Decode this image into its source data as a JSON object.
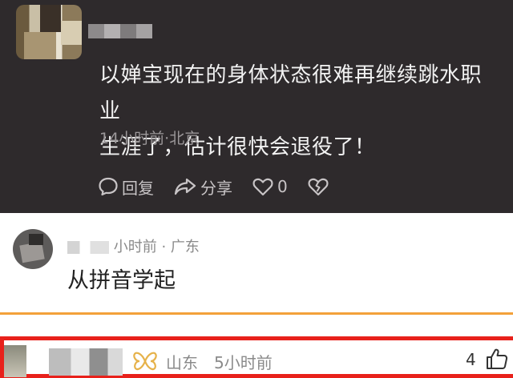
{
  "dark_comment": {
    "text_line1": "以婵宝现在的身体状态很难再继续跳水职业",
    "text_line2": "生涯了，估计很快会退役了！",
    "meta": "14小时前·北京",
    "actions": {
      "reply_label": "回复",
      "share_label": "分享",
      "like_count": "0"
    }
  },
  "light_comment": {
    "meta": "小时前 · 广东",
    "text": "从拼音学起"
  },
  "highlighted_row": {
    "location": "山东",
    "time": "5小时前",
    "like_count": "4"
  },
  "colors": {
    "dark_bg": "#2e2a2c",
    "highlight_border": "#e8211b",
    "divider": "#f3a13a",
    "vip_badge": "#e6b24a"
  }
}
